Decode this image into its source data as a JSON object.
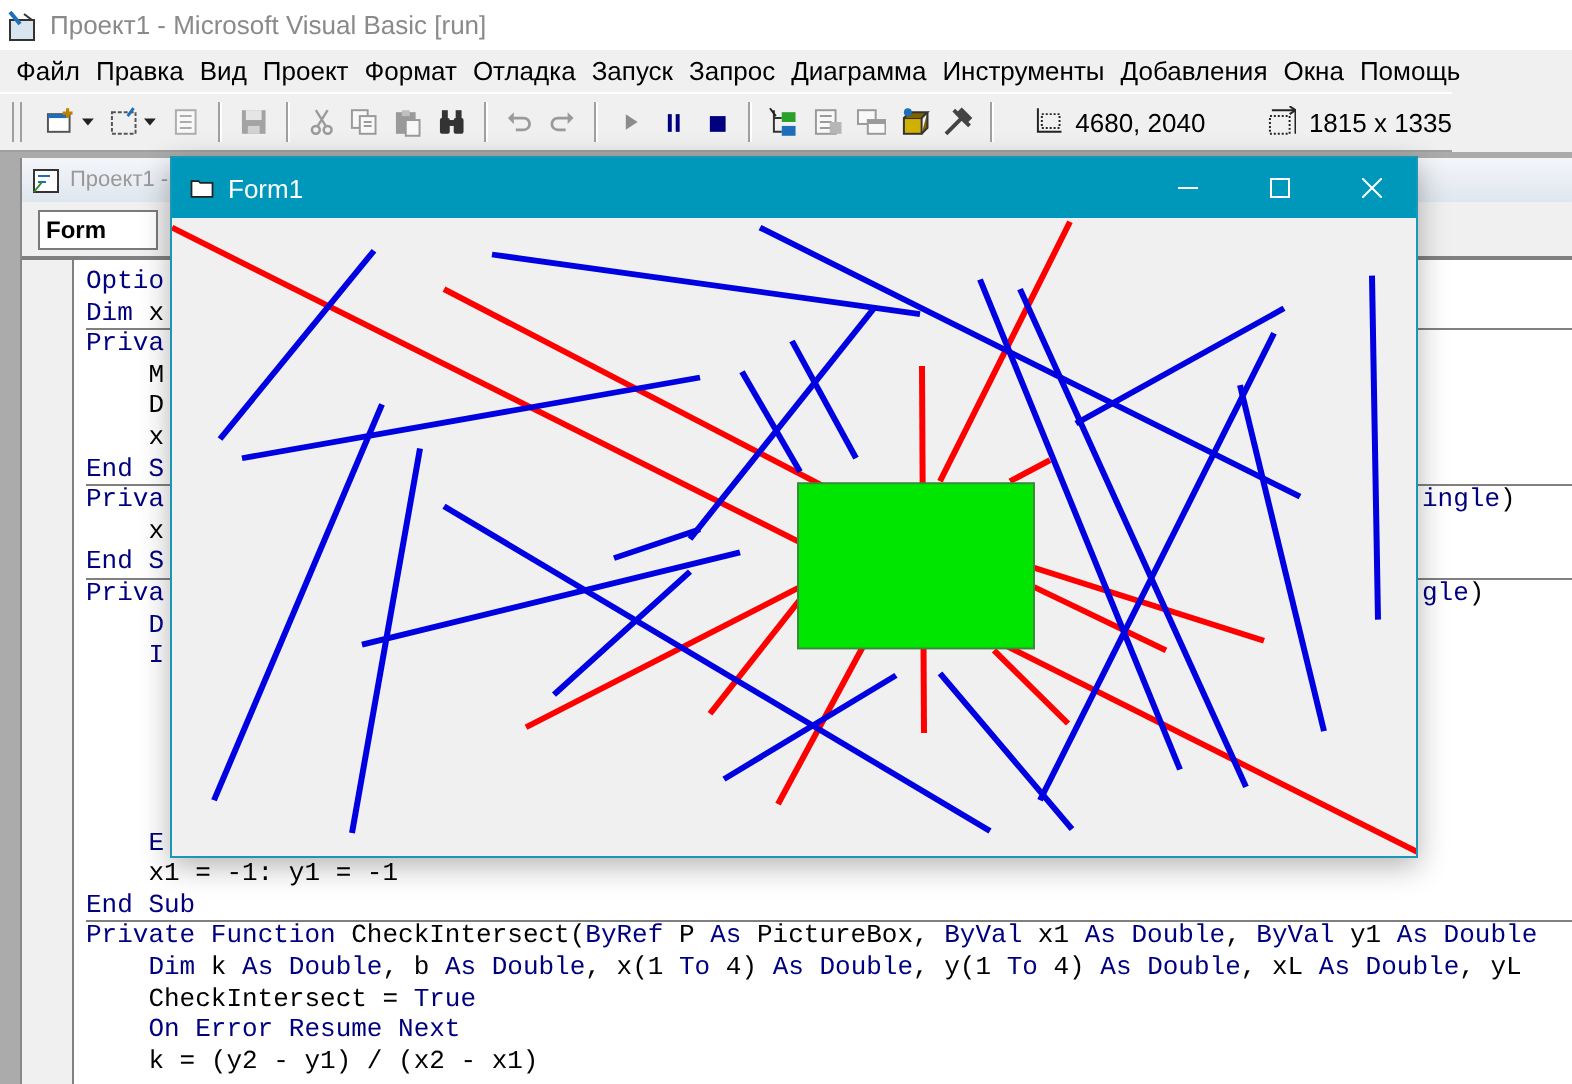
{
  "app_window": {
    "title": "Проект1 - Microsoft Visual Basic [run]",
    "active": false
  },
  "menu": [
    {
      "label": "Файл"
    },
    {
      "label": "Правка"
    },
    {
      "label": "Вид"
    },
    {
      "label": "Проект"
    },
    {
      "label": "Формат"
    },
    {
      "label": "Отладка"
    },
    {
      "label": "Запуск"
    },
    {
      "label": "Запрос"
    },
    {
      "label": "Диаграмма"
    },
    {
      "label": "Инструменты"
    },
    {
      "label": "Добавления"
    },
    {
      "label": "Окна"
    },
    {
      "label": "Помощь"
    }
  ],
  "toolbar": {
    "groups": [
      [
        {
          "kind": "add-project",
          "dropdown": true,
          "disabled": false
        },
        {
          "kind": "add-form",
          "dropdown": true,
          "disabled": false
        },
        {
          "kind": "menu-editor",
          "dropdown": false,
          "disabled": true
        }
      ],
      [
        {
          "kind": "save",
          "dropdown": false,
          "disabled": true
        }
      ],
      [
        {
          "kind": "cut",
          "dropdown": false,
          "disabled": true
        },
        {
          "kind": "copy",
          "dropdown": false,
          "disabled": true
        },
        {
          "kind": "paste",
          "dropdown": false,
          "disabled": true
        },
        {
          "kind": "find",
          "dropdown": false,
          "disabled": false
        }
      ],
      [
        {
          "kind": "undo",
          "dropdown": false,
          "disabled": true
        },
        {
          "kind": "redo",
          "dropdown": false,
          "disabled": true
        }
      ],
      [
        {
          "kind": "run",
          "dropdown": false,
          "disabled": true
        },
        {
          "kind": "pause",
          "dropdown": false,
          "disabled": false
        },
        {
          "kind": "stop",
          "dropdown": false,
          "disabled": false
        }
      ],
      [
        {
          "kind": "project-explorer",
          "dropdown": false,
          "disabled": false
        },
        {
          "kind": "properties",
          "dropdown": false,
          "disabled": true
        },
        {
          "kind": "form-layout",
          "dropdown": false,
          "disabled": true
        },
        {
          "kind": "object-browser",
          "dropdown": false,
          "disabled": false
        },
        {
          "kind": "toolbox",
          "dropdown": false,
          "disabled": false
        }
      ]
    ],
    "position": "4680, 2040",
    "size": "1815 x 1335"
  },
  "code_window": {
    "title": "Проект1 -",
    "object": "Form",
    "blocks": [
      {
        "kind": "declarations",
        "lines": [
          [
            {
              "text": "Optio",
              "kind": "keyword"
            }
          ],
          [
            {
              "text": "Dim",
              "kind": "keyword"
            },
            {
              "text": " x",
              "kind": "code"
            }
          ]
        ]
      },
      {
        "kind": "procedure",
        "header": {
          "segments": [
            {
              "text": "Priva",
              "kind": "keyword"
            }
          ]
        },
        "body": [
          {
            "kind": "code",
            "segments": [
              {
                "text": "M",
                "kind": "code"
              }
            ]
          },
          {
            "kind": "code",
            "segments": [
              {
                "text": "D",
                "kind": "code"
              }
            ]
          },
          {
            "kind": "code",
            "segments": [
              {
                "text": "x",
                "kind": "code"
              }
            ]
          }
        ],
        "footer": [
          {
            "text": "End S",
            "kind": "keyword"
          }
        ]
      },
      {
        "kind": "procedure",
        "header": {
          "segments": [
            {
              "text": "Priva",
              "kind": "keyword"
            }
          ],
          "tail": [
            {
              "text": "ingle",
              "kind": "keyword"
            },
            {
              "text": ")",
              "kind": "code"
            }
          ]
        },
        "body": [
          {
            "kind": "code",
            "segments": [
              {
                "text": "x",
                "kind": "code"
              }
            ]
          }
        ],
        "footer": [
          {
            "text": "End S",
            "kind": "keyword"
          }
        ]
      },
      {
        "kind": "procedure",
        "header": {
          "segments": [
            {
              "text": "Priva",
              "kind": "keyword"
            }
          ],
          "tail": [
            {
              "text": "gle",
              "kind": "keyword"
            },
            {
              "text": ")",
              "kind": "code"
            }
          ]
        },
        "body": [
          {
            "kind": "code",
            "segments": [
              {
                "text": "D",
                "kind": "keyword"
              }
            ]
          },
          {
            "kind": "code",
            "segments": [
              {
                "text": "I",
                "kind": "keyword"
              }
            ]
          },
          {
            "kind": "blank"
          },
          {
            "kind": "blank"
          },
          {
            "kind": "blank"
          },
          {
            "kind": "blank"
          },
          {
            "kind": "blank"
          },
          {
            "kind": "code",
            "segments": [
              {
                "text": "E",
                "kind": "keyword"
              }
            ]
          },
          {
            "kind": "code",
            "segments": [
              {
                "text": "x1 = -1: y1 = -1",
                "kind": "code"
              }
            ]
          }
        ],
        "footer": [
          {
            "text": "End Sub",
            "kind": "keyword"
          }
        ]
      },
      {
        "kind": "procedure",
        "header": {
          "segments": [
            {
              "text": "Private Function",
              "kind": "keyword"
            },
            {
              "text": " CheckIntersect(",
              "kind": "code"
            },
            {
              "text": "ByRef",
              "kind": "keyword"
            },
            {
              "text": " P ",
              "kind": "code"
            },
            {
              "text": "As",
              "kind": "keyword"
            },
            {
              "text": " PictureBox, ",
              "kind": "code"
            },
            {
              "text": "ByVal",
              "kind": "keyword"
            },
            {
              "text": " x1 ",
              "kind": "code"
            },
            {
              "text": "As Double",
              "kind": "keyword"
            },
            {
              "text": ", ",
              "kind": "code"
            },
            {
              "text": "ByVal",
              "kind": "keyword"
            },
            {
              "text": " y1 ",
              "kind": "code"
            },
            {
              "text": "As Double",
              "kind": "keyword"
            }
          ]
        },
        "body": [
          {
            "kind": "code",
            "segments": [
              {
                "text": "Dim",
                "kind": "keyword"
              },
              {
                "text": " k ",
                "kind": "code"
              },
              {
                "text": "As Double",
                "kind": "keyword"
              },
              {
                "text": ", b ",
                "kind": "code"
              },
              {
                "text": "As Double",
                "kind": "keyword"
              },
              {
                "text": ", x(1 ",
                "kind": "code"
              },
              {
                "text": "To",
                "kind": "keyword"
              },
              {
                "text": " 4) ",
                "kind": "code"
              },
              {
                "text": "As Double",
                "kind": "keyword"
              },
              {
                "text": ", y(1 ",
                "kind": "code"
              },
              {
                "text": "To",
                "kind": "keyword"
              },
              {
                "text": " 4) ",
                "kind": "code"
              },
              {
                "text": "As Double",
                "kind": "keyword"
              },
              {
                "text": ", xL ",
                "kind": "code"
              },
              {
                "text": "As Double",
                "kind": "keyword"
              },
              {
                "text": ", yL",
                "kind": "code"
              }
            ]
          },
          {
            "kind": "code",
            "segments": [
              {
                "text": "CheckIntersect = ",
                "kind": "code"
              },
              {
                "text": "True",
                "kind": "keyword"
              }
            ]
          },
          {
            "kind": "code",
            "segments": [
              {
                "text": "On Error Resume Next",
                "kind": "keyword"
              }
            ]
          },
          {
            "kind": "code",
            "segments": [
              {
                "text": "k = (y2 - y1) / (x2 - x1)",
                "kind": "code"
              }
            ]
          }
        ]
      }
    ]
  },
  "form_window": {
    "title": "Form1"
  }
}
